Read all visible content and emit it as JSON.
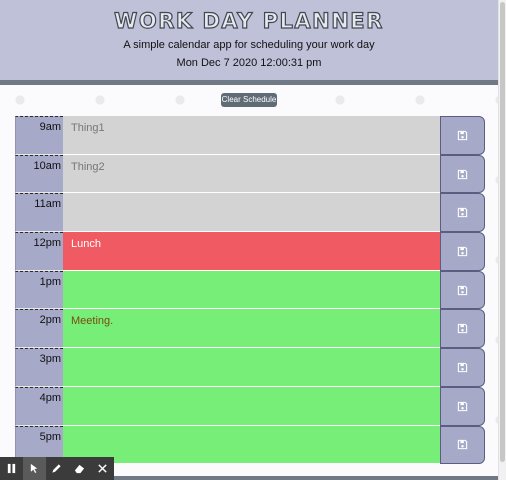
{
  "header": {
    "title": "WORK DAY PLANNER",
    "subtitle": "A simple calendar app for scheduling your work day",
    "current_day": "Mon Dec 7 2020 12:00:31 pm"
  },
  "clear_button": {
    "label": "Clear Schedule"
  },
  "rows": [
    {
      "hour": "9am",
      "text": "Thing1",
      "state": "past"
    },
    {
      "hour": "10am",
      "text": "Thing2",
      "state": "past"
    },
    {
      "hour": "11am",
      "text": "",
      "state": "past"
    },
    {
      "hour": "12pm",
      "text": "Lunch",
      "state": "present"
    },
    {
      "hour": "1pm",
      "text": "",
      "state": "future"
    },
    {
      "hour": "2pm",
      "text": "Meeting.",
      "state": "future"
    },
    {
      "hour": "3pm",
      "text": "",
      "state": "future"
    },
    {
      "hour": "4pm",
      "text": "",
      "state": "future"
    },
    {
      "hour": "5pm",
      "text": "",
      "state": "future"
    }
  ],
  "icons": {
    "save": "save-icon",
    "pause": "pause-icon",
    "pointer": "pointer-icon",
    "pen": "pen-icon",
    "eraser": "eraser-icon",
    "close": "close-icon"
  },
  "colors": {
    "past": "#d3d3d3",
    "present": "#f05a62",
    "future": "#77ee77",
    "header": "#bfc1d9",
    "hour_cell": "#a7a9c9",
    "clear_button": "#5f6b75"
  }
}
